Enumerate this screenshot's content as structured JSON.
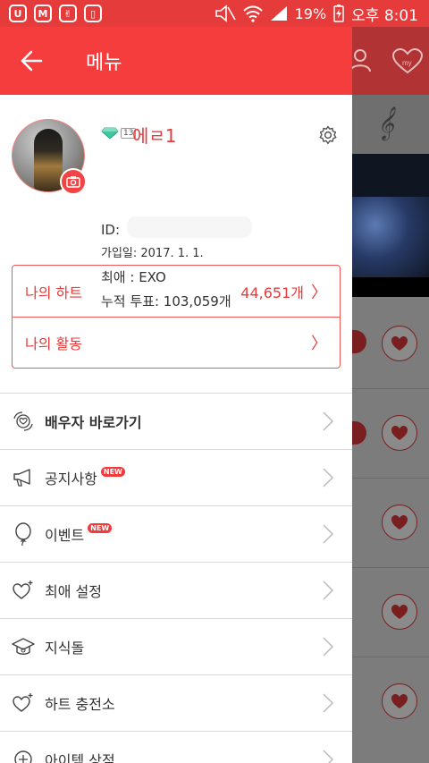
{
  "status_bar": {
    "battery_percent": "19%",
    "time": "오후 8:01",
    "left_icons": [
      "u-plus-icon",
      "m-icon",
      "victory-icon",
      "phone-icon"
    ]
  },
  "drawer": {
    "title": "메뉴",
    "profile": {
      "level": "13",
      "nickname": "에ㄹ1",
      "id_label": "ID:",
      "join_date": "가입일: 2017. 1. 1.",
      "favorite": "최애 : EXO",
      "votes": "누적 투표: 103,059개"
    },
    "summary": [
      {
        "label": "나의 하트",
        "value": "44,651개"
      },
      {
        "label": "나의 활동",
        "value": ""
      }
    ],
    "menu": [
      {
        "label": "배우자 바로가기",
        "icon": "spouse-icon",
        "new": false,
        "bold": true
      },
      {
        "label": "공지사항",
        "icon": "megaphone-icon",
        "new": true,
        "bold": false
      },
      {
        "label": "이벤트",
        "icon": "balloon-icon",
        "new": true,
        "bold": false
      },
      {
        "label": "최애 설정",
        "icon": "heart-plus-icon",
        "new": false,
        "bold": false
      },
      {
        "label": "지식돌",
        "icon": "graduation-cap-icon",
        "new": false,
        "bold": false
      },
      {
        "label": "하트 충전소",
        "icon": "heart-charge-icon",
        "new": false,
        "bold": false
      },
      {
        "label": "아이템 상점",
        "icon": "shop-icon",
        "new": false,
        "bold": false
      }
    ],
    "new_badge": "NEW"
  },
  "background": {
    "my_label": "my"
  },
  "colors": {
    "accent": "#f53d3d",
    "status_bar": "#e53b3b",
    "divider": "#d8d8d8"
  }
}
